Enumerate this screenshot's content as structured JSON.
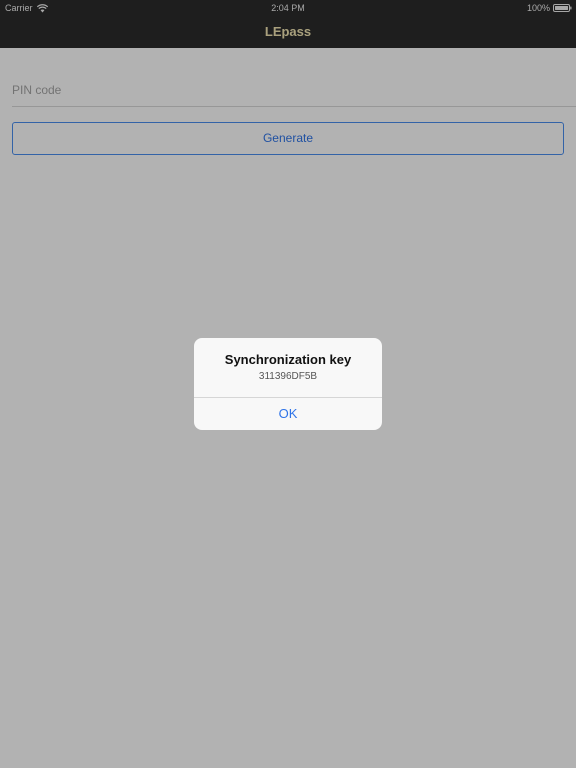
{
  "status_bar": {
    "carrier": "Carrier",
    "time": "2:04 PM",
    "battery": "100%"
  },
  "nav": {
    "title": "LEpass"
  },
  "form": {
    "pin_placeholder": "PIN code",
    "pin_value": "",
    "generate_label": "Generate"
  },
  "alert": {
    "title": "Synchronization key",
    "message": "311396DF5B",
    "ok_label": "OK"
  },
  "colors": {
    "accent": "#2f74e8",
    "nav_background": "#2b2b2b",
    "nav_title": "#f2e6b3"
  },
  "icons": {
    "wifi": "wifi-icon",
    "battery": "battery-icon"
  }
}
